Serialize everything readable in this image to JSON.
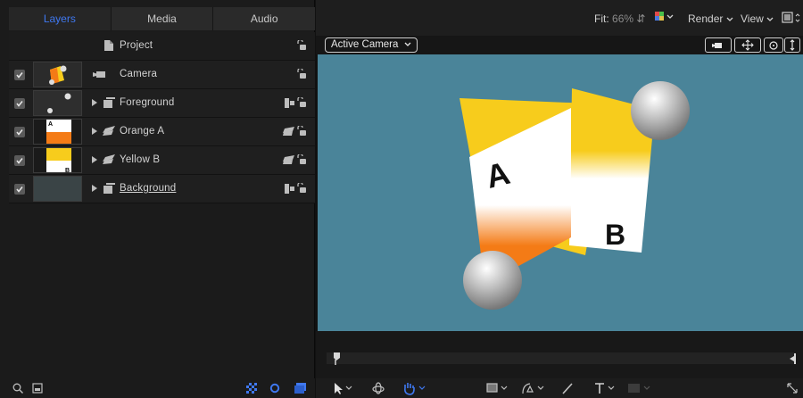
{
  "tabs": [
    {
      "label": "Layers",
      "active": true
    },
    {
      "label": "Media",
      "active": false
    },
    {
      "label": "Audio",
      "active": false
    }
  ],
  "layers": [
    {
      "name": "Project",
      "type": "project"
    },
    {
      "name": "Camera",
      "type": "camera",
      "checked": true
    },
    {
      "name": "Foreground",
      "type": "group",
      "checked": true
    },
    {
      "name": "Orange A",
      "type": "replicator",
      "checked": true
    },
    {
      "name": "Yellow B",
      "type": "replicator",
      "checked": true
    },
    {
      "name": "Background",
      "type": "group",
      "checked": true,
      "selected_name": true
    }
  ],
  "toolbar": {
    "fit_label": "Fit:",
    "fit_value": "66%",
    "render_label": "Render",
    "view_label": "View"
  },
  "viewer": {
    "camera_label": "Active Camera",
    "canvas_color": "#4a8499"
  },
  "scene": {
    "card_a_letter": "A",
    "card_b_letter": "B"
  },
  "colors": {
    "accent": "#3f78f0",
    "orange": "#f47b16",
    "yellow": "#f7cc1c"
  }
}
